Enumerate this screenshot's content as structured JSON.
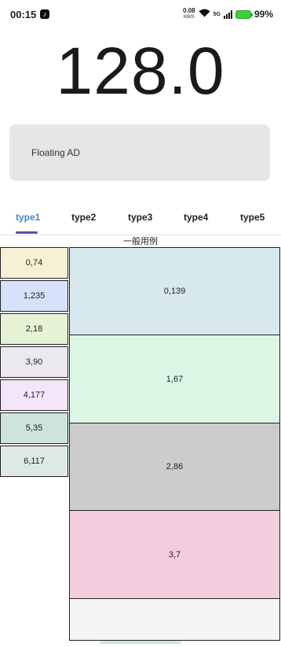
{
  "status_bar": {
    "time": "00:15",
    "net_speed_value": "0.08",
    "net_speed_unit": "KB/S",
    "signal_label": "5G",
    "battery": "99%"
  },
  "display": {
    "value": "128.0"
  },
  "ad": {
    "label": "Floating AD"
  },
  "tabs": [
    {
      "label": "type1",
      "active": true
    },
    {
      "label": "type2"
    },
    {
      "label": "type3"
    },
    {
      "label": "type4"
    },
    {
      "label": "type5"
    }
  ],
  "caption": "一般用例",
  "left_items": [
    {
      "label": "0,74",
      "color": "#f8f0d4"
    },
    {
      "label": "1,235",
      "color": "#d6e1fa"
    },
    {
      "label": "2,18",
      "color": "#e6f2d4"
    },
    {
      "label": "3,90",
      "color": "#ebe9ef"
    },
    {
      "label": "4,177",
      "color": "#f4e6fa"
    },
    {
      "label": "5,35",
      "color": "#cce4dc"
    },
    {
      "label": "6,117",
      "color": "#dee8e6"
    }
  ],
  "right_items": [
    {
      "label": "0,139",
      "color": "#d8e8ef"
    },
    {
      "label": "1,67",
      "color": "#dcf6e6"
    },
    {
      "label": "2,86",
      "color": "#cccccc"
    },
    {
      "label": "3,7",
      "color": "#f3cddd"
    },
    {
      "label": "",
      "color": "#f4f6f5"
    }
  ]
}
